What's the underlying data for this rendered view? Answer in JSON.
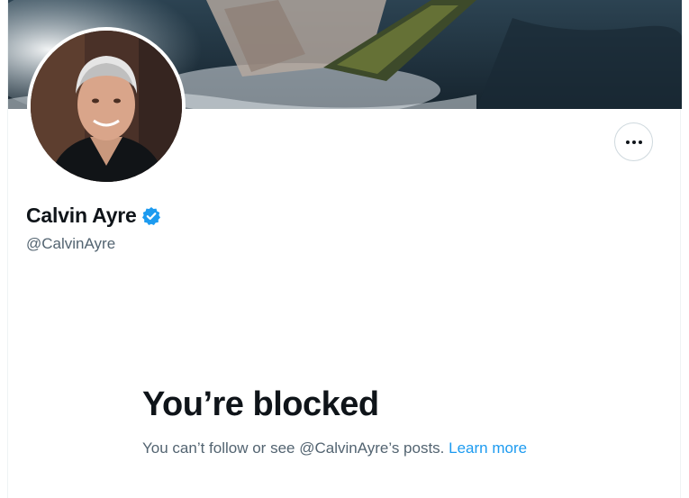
{
  "profile": {
    "display_name": "Calvin Ayre",
    "handle": "@CalvinAyre",
    "verified": true
  },
  "icons": {
    "verified": "verified-badge-icon",
    "more": "more-horizontal-icon"
  },
  "blocked": {
    "title": "You’re blocked",
    "message": "You can’t follow or see @CalvinAyre’s posts.",
    "link_text": "Learn more"
  },
  "colors": {
    "accent": "#1d9bf0",
    "text_primary": "#0f1419",
    "text_secondary": "#536471"
  }
}
